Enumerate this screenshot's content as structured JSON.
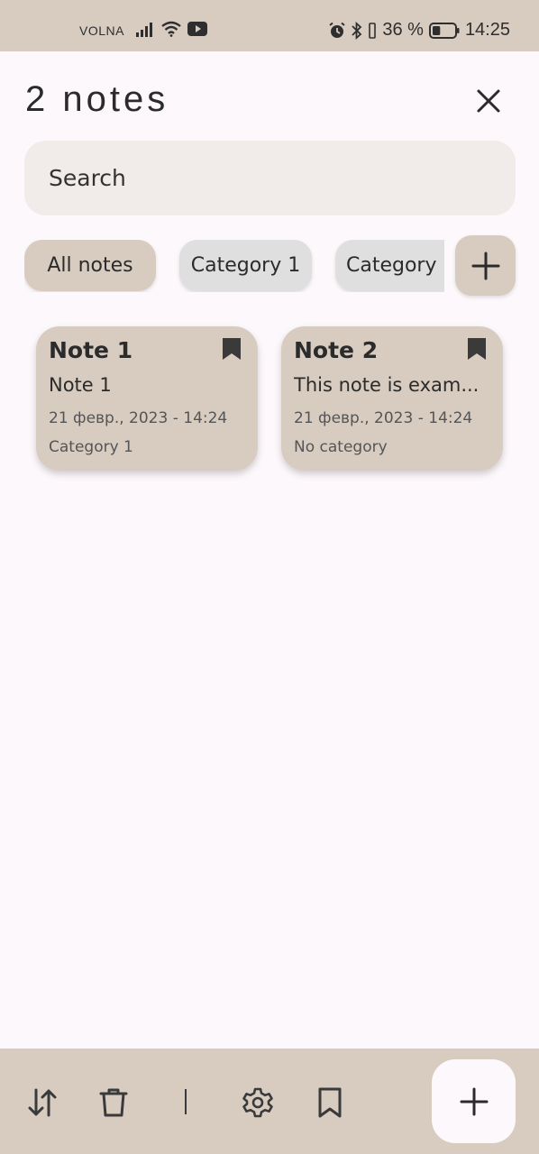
{
  "status_bar": {
    "carrier": "VOLNA",
    "battery_text": "36 %",
    "time": "14:25",
    "battery_level": 0.36,
    "icons": [
      "signal-icon",
      "wifi-icon",
      "youtube-icon",
      "alarm-icon",
      "bluetooth-icon",
      "vibrate-icon",
      "battery-icon"
    ]
  },
  "header": {
    "title": "2 notes",
    "close_icon": "close-icon"
  },
  "search": {
    "placeholder": "Search"
  },
  "categories": {
    "chips": [
      {
        "label": "All notes",
        "active": true
      },
      {
        "label": "Category 1",
        "active": false
      },
      {
        "label": "Category",
        "active": false
      }
    ],
    "add_icon": "plus-icon"
  },
  "notes": [
    {
      "title": "Note 1",
      "body": "Note 1",
      "date": "21 февр., 2023 - 14:24",
      "category": "Category 1",
      "bookmarked": true
    },
    {
      "title": "Note 2",
      "body": "This note is exam...",
      "date": "21 февр., 2023 - 14:24",
      "category": "No category",
      "bookmarked": true
    }
  ],
  "bottom_bar": {
    "icons": [
      "sort-icon",
      "trash-icon",
      "settings-icon",
      "bookmark-icon"
    ],
    "fab_icon": "plus-icon"
  },
  "colors": {
    "accent": "#d8ccc1",
    "background": "#fdf8fb",
    "search_bg": "#f1ebe9",
    "chip_inactive": "#e0dfdf",
    "text": "#2b2b2b"
  }
}
